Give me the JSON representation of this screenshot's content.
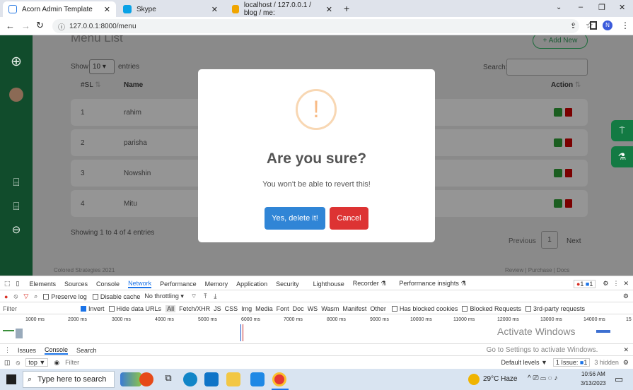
{
  "browser": {
    "tabs": [
      {
        "label": "Acorn Admin Template",
        "close": "✕"
      },
      {
        "label": "Skype",
        "close": "✕"
      },
      {
        "label": "localhost / 127.0.0.1 / blog / me:",
        "close": "✕"
      }
    ],
    "new_tab": "+",
    "url": "127.0.0.1:8000/menu",
    "profile_initial": "N",
    "window_controls": [
      "⌄",
      "–",
      "❐",
      "✕"
    ]
  },
  "page": {
    "heading": "Menu List",
    "add_new": "+ Add New",
    "show_label": "Show",
    "entries_select": "10",
    "entries_label": "entries",
    "search_label": "Search:",
    "columns": [
      "#SL",
      "Name",
      "Action"
    ],
    "rows": [
      {
        "sl": "1",
        "name": "rahim"
      },
      {
        "sl": "2",
        "name": "parisha"
      },
      {
        "sl": "3",
        "name": "Nowshin"
      },
      {
        "sl": "4",
        "name": "Mitu"
      }
    ],
    "showing": "Showing 1 to 4 of 4 entries",
    "pagination": {
      "previous": "Previous",
      "current": "1",
      "next": "Next"
    },
    "footer_left": "Colored Strategies 2021",
    "footer_links": "Review | Purchase | Docs"
  },
  "modal": {
    "icon": "!",
    "title": "Are you sure?",
    "text": "You won't be able to revert this!",
    "confirm": "Yes, delete it!",
    "cancel": "Cancel"
  },
  "devtools": {
    "tabs": [
      "Elements",
      "Sources",
      "Console",
      "Network",
      "Performance",
      "Memory",
      "Application",
      "Security",
      "Lighthouse",
      "Recorder ⚗",
      "Performance insights ⚗"
    ],
    "selected_tab": "Network",
    "errors": "1",
    "messages": "1",
    "toolbar": [
      "Preserve log",
      "Disable cache",
      "No throttling"
    ],
    "filter_placeholder": "Filter",
    "filter_types": [
      "Invert",
      "Hide data URLs",
      "All",
      "Fetch/XHR",
      "JS",
      "CSS",
      "Img",
      "Media",
      "Font",
      "Doc",
      "WS",
      "Wasm",
      "Manifest",
      "Other",
      "Has blocked cookies",
      "Blocked Requests",
      "3rd-party requests"
    ],
    "timeline_ticks": [
      "1000 ms",
      "2000 ms",
      "3000 ms",
      "4000 ms",
      "5000 ms",
      "6000 ms",
      "7000 ms",
      "8000 ms",
      "9000 ms",
      "10000 ms",
      "11000 ms",
      "12000 ms",
      "13000 ms",
      "14000 ms",
      "15"
    ],
    "drawer_tabs": [
      "Issues",
      "Console",
      "Search"
    ],
    "context": "top ▼",
    "console_filter": "Filter",
    "default_levels": "Default levels ▼",
    "issue_label": "1 Issue:",
    "issue_count": "1",
    "hidden": "3 hidden",
    "watermark_title": "Activate Windows",
    "watermark_text": "Go to Settings to activate Windows."
  },
  "taskbar": {
    "search_placeholder": "Type here to search",
    "weather": "29°C  Haze",
    "time": "10:56 AM",
    "date": "3/13/2023"
  }
}
